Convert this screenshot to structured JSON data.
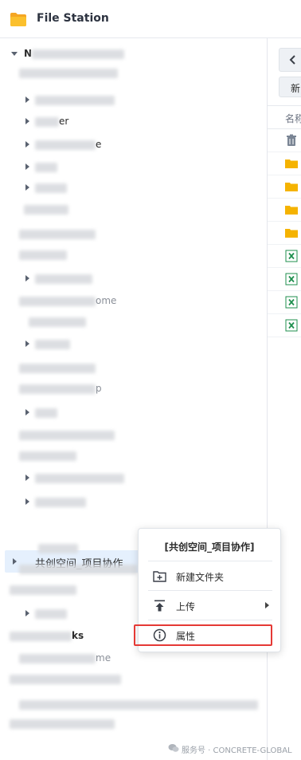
{
  "window": {
    "title": "File Station",
    "app_icon": "folder-app-icon"
  },
  "tree": {
    "root_label_visible": "N",
    "peek_labels": {
      "row_3": "er",
      "row_4": "e",
      "row_10": "ome",
      "row_14": "p",
      "row_24": "ks",
      "row_25": "me"
    },
    "selected_item": "共创空间_项目协作"
  },
  "context_menu": {
    "header": "[共创空间_项目协作]",
    "items": [
      {
        "label": "新建文件夹",
        "icon": "new-folder-icon"
      },
      {
        "label": "上传",
        "icon": "upload-icon",
        "has_submenu": true
      },
      {
        "label": "属性",
        "icon": "info-icon",
        "highlighted": true
      }
    ]
  },
  "right_pane": {
    "new_button_label": "新",
    "column_header": "名称",
    "files": [
      {
        "type": "recycle-bin",
        "icon": "trash-icon"
      },
      {
        "type": "folder",
        "icon": "folder-icon"
      },
      {
        "type": "folder",
        "icon": "folder-icon"
      },
      {
        "type": "folder",
        "icon": "folder-icon"
      },
      {
        "type": "folder",
        "icon": "folder-icon"
      },
      {
        "type": "excel",
        "icon": "excel-file-icon"
      },
      {
        "type": "excel",
        "icon": "excel-file-icon"
      },
      {
        "type": "excel",
        "icon": "excel-file-icon"
      },
      {
        "type": "excel",
        "icon": "excel-file-icon"
      }
    ]
  },
  "watermark": "服务号 · CONCRETE-GLOBAL",
  "colors": {
    "selection": "#e5f0fd",
    "highlight_border": "#e53935",
    "folder": "#f5b301",
    "excel": "#1f8f4e"
  }
}
